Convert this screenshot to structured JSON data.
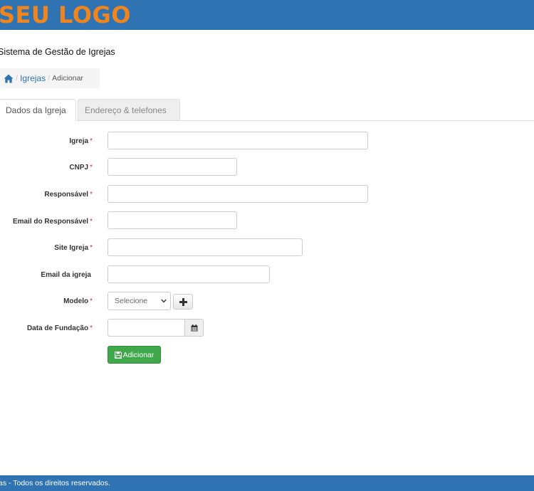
{
  "header": {
    "logo_text": "SEU LOGO",
    "brand_color": "#2f73b3",
    "logo_color": "#f0851d"
  },
  "system_title": "Sistema de Gestão de Igrejas",
  "breadcrumb": {
    "home_icon": "home-icon",
    "items": [
      {
        "label": "Igrejas",
        "link": true
      },
      {
        "label": "Adicionar",
        "link": false
      }
    ],
    "separator": "/"
  },
  "tabs": [
    {
      "label": "Dados da Igreja",
      "active": true
    },
    {
      "label": "Endereço & telefones",
      "active": false
    }
  ],
  "form": {
    "required_marker": "*",
    "fields": {
      "igreja": {
        "label": "Igreja",
        "required": true,
        "value": "",
        "placeholder": ""
      },
      "cnpj": {
        "label": "CNPJ",
        "required": true,
        "value": "",
        "placeholder": ""
      },
      "responsavel": {
        "label": "Responsável",
        "required": true,
        "value": "",
        "placeholder": ""
      },
      "email_responsavel": {
        "label": "Email do Responsável",
        "required": true,
        "value": "",
        "placeholder": ""
      },
      "site_igreja": {
        "label": "Site Igreja",
        "required": true,
        "value": "",
        "placeholder": ""
      },
      "email_igreja": {
        "label": "Email da igreja",
        "required": false,
        "value": "",
        "placeholder": ""
      },
      "modelo": {
        "label": "Modelo",
        "required": true,
        "selected": "Selecione"
      },
      "data_fundacao": {
        "label": "Data de Fundação",
        "required": true,
        "value": "",
        "placeholder": ""
      }
    },
    "add_model_icon": "plus-icon",
    "calendar_icon": "calendar-icon",
    "submit": {
      "label": "Adicionar",
      "icon": "save-icon",
      "color": "#3ea84a"
    }
  },
  "footer": {
    "text": "as - Todos os direitos reservados."
  }
}
